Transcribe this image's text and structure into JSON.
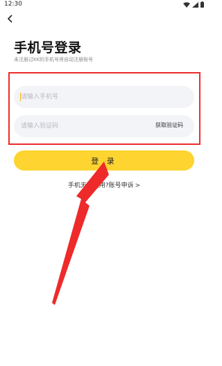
{
  "status_bar": {
    "time": "12:30"
  },
  "header": {
    "title": "手机号登录",
    "subtitle": "未注册过KK的手机号将自动注册账号"
  },
  "form": {
    "phone_placeholder": "请输入手机号",
    "code_placeholder": "请输入验证码",
    "get_code_label": "获取验证码"
  },
  "login_button": "登 录",
  "help_link": "手机无法使用?账号申诉",
  "colors": {
    "accent": "#fdd430",
    "annotation": "#ee2a2a"
  }
}
